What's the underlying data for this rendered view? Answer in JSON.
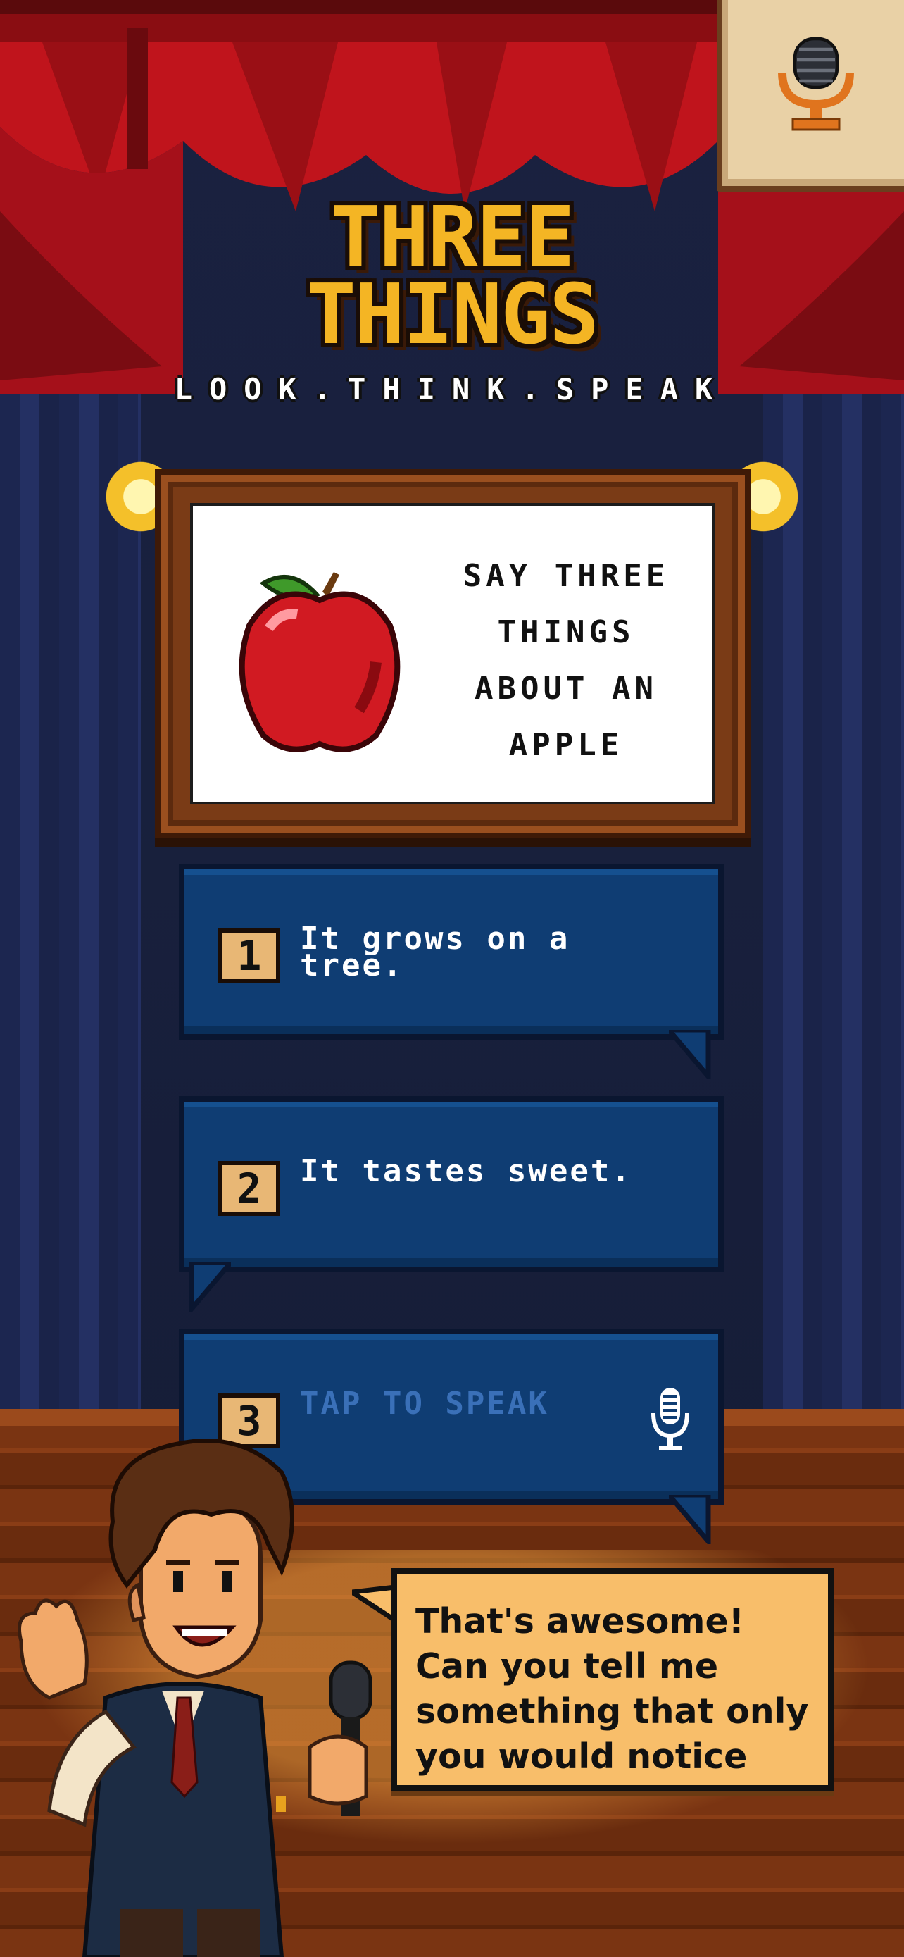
{
  "title": {
    "line1": "THREE",
    "line2": "THINGS"
  },
  "subtitle": "LOOK.THINK.SPEAK",
  "prompt": {
    "text": "SAY THREE THINGS ABOUT AN APPLE",
    "image": "apple"
  },
  "answers": [
    {
      "number": "1",
      "text": "It grows on a tree."
    },
    {
      "number": "2",
      "text": "It tastes sweet."
    },
    {
      "number": "3",
      "placeholder": "TAP TO SPEAK",
      "icon": "microphone-icon"
    }
  ],
  "host_speech": "That's awesome! Can you tell me something that only you would notice",
  "top_button": {
    "icon": "microphone-icon"
  },
  "colors": {
    "title": "#f4b524",
    "curtain_red": "#c0141c",
    "bubble_blue": "#0f3d73",
    "placeholder_blue": "#3a70b8",
    "speech_bg": "#f8be6a",
    "frame_wood": "#7a3b16"
  }
}
